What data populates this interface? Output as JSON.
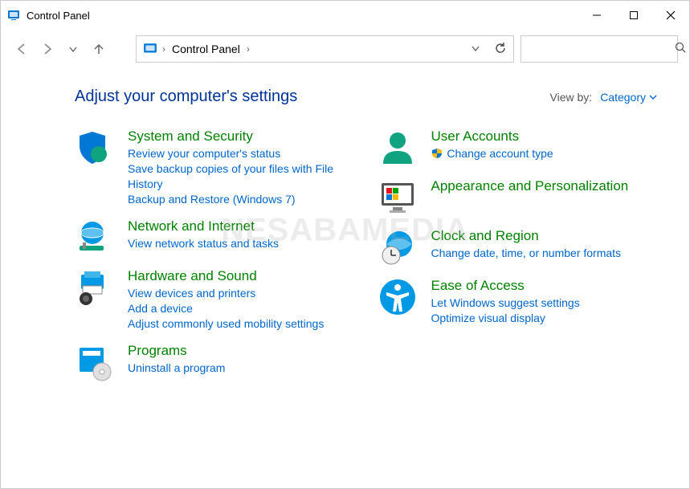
{
  "window": {
    "title": "Control Panel"
  },
  "breadcrumb": {
    "location": "Control Panel"
  },
  "search": {
    "placeholder": ""
  },
  "heading": "Adjust your computer's settings",
  "viewby": {
    "label": "View by:",
    "value": "Category"
  },
  "watermark": "NESABAMEDIA",
  "cats": {
    "system": {
      "title": "System and Security",
      "links": [
        "Review your computer's status",
        "Save backup copies of your files with File History",
        "Backup and Restore (Windows 7)"
      ]
    },
    "network": {
      "title": "Network and Internet",
      "links": [
        "View network status and tasks"
      ]
    },
    "hardware": {
      "title": "Hardware and Sound",
      "links": [
        "View devices and printers",
        "Add a device",
        "Adjust commonly used mobility settings"
      ]
    },
    "programs": {
      "title": "Programs",
      "links": [
        "Uninstall a program"
      ]
    },
    "users": {
      "title": "User Accounts",
      "links": [
        "Change account type"
      ]
    },
    "appearance": {
      "title": "Appearance and Personalization",
      "links": []
    },
    "clock": {
      "title": "Clock and Region",
      "links": [
        "Change date, time, or number formats"
      ]
    },
    "ease": {
      "title": "Ease of Access",
      "links": [
        "Let Windows suggest settings",
        "Optimize visual display"
      ]
    }
  }
}
